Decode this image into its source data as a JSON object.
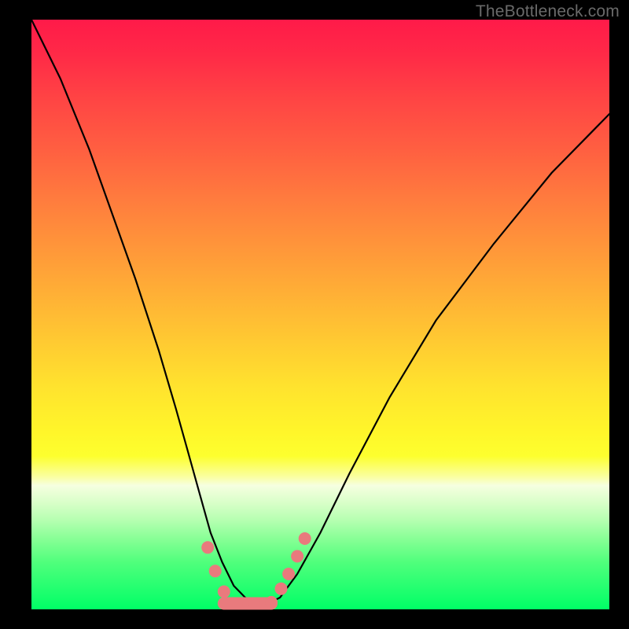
{
  "watermark": "TheBottleneck.com",
  "chart_data": {
    "type": "line",
    "title": "",
    "xlabel": "",
    "ylabel": "",
    "xlim": [
      0,
      100
    ],
    "ylim": [
      0,
      100
    ],
    "series": [
      {
        "name": "bottleneck-curve",
        "x": [
          0,
          5,
          10,
          14,
          18,
          22,
          25,
          27,
          29,
          31,
          33,
          35,
          37,
          39,
          41,
          43,
          46,
          50,
          55,
          62,
          70,
          80,
          90,
          100
        ],
        "values": [
          100,
          90,
          78,
          67,
          56,
          44,
          34,
          27,
          20,
          13,
          8,
          4,
          2,
          1,
          1,
          2,
          6,
          13,
          23,
          36,
          49,
          62,
          74,
          84
        ]
      }
    ],
    "markers": {
      "name": "highlight-dots",
      "color": "#e97a7d",
      "points": [
        {
          "x": 30.5,
          "y": 10.5
        },
        {
          "x": 31.8,
          "y": 6.5
        },
        {
          "x": 33.3,
          "y": 3.0
        },
        {
          "x": 35.5,
          "y": 1.0
        },
        {
          "x": 38.5,
          "y": 1.0
        },
        {
          "x": 41.5,
          "y": 1.2
        },
        {
          "x": 43.2,
          "y": 3.5
        },
        {
          "x": 44.5,
          "y": 6.0
        },
        {
          "x": 46.0,
          "y": 9.0
        },
        {
          "x": 47.3,
          "y": 12.0
        }
      ]
    },
    "trough_bar": {
      "color": "#e97a7d",
      "x_start": 33.3,
      "x_end": 41.5,
      "y": 1.0
    }
  }
}
